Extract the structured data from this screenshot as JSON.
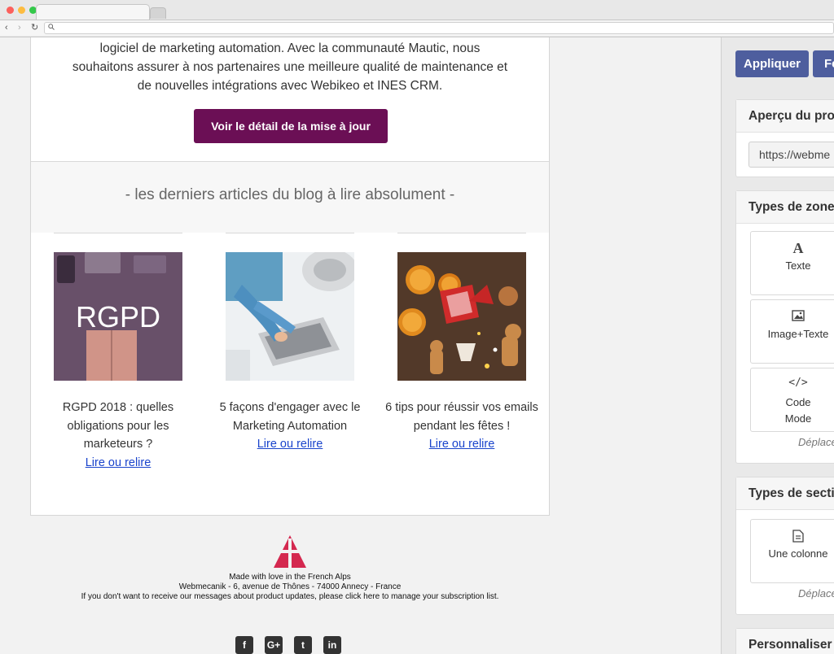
{
  "browser": {
    "back_label": "‹",
    "forward_label": "›",
    "reload_label": "↻",
    "url": ""
  },
  "email": {
    "intro_lines": [
      "logiciel de marketing automation. Avec la communauté Mautic, nous",
      "souhaitons assurer à nos partenaires une meilleure qualité de maintenance et",
      "de nouvelles intégrations avec Webikeo et INES CRM."
    ],
    "cta_label": "Voir le détail de la mise à jour",
    "blog_heading": "- les derniers articles du blog à lire absolument -",
    "articles": [
      {
        "thumb_text": "RGPD",
        "title": "RGPD 2018 : quelles obligations pour les marketeurs ?",
        "link": "Lire ou relire"
      },
      {
        "thumb_text": "",
        "title": "5 façons d'engager avec le Marketing Automation",
        "link": "Lire ou relire"
      },
      {
        "thumb_text": "",
        "title": "6 tips pour réussir vos emails pendant les fêtes !",
        "link": "Lire ou relire"
      }
    ],
    "footer": {
      "line1": "Made with love in the French Alps",
      "line2": "Webmecanik - 6, avenue de Thônes - 74000 Annecy - France",
      "line3": "If you don't want to receive our messages about product updates, please click here to manage your subscription list."
    },
    "social": [
      {
        "icon": "facebook-icon",
        "glyph": "f"
      },
      {
        "icon": "google-plus-icon",
        "glyph": "G+"
      },
      {
        "icon": "twitter-icon",
        "glyph": "t"
      },
      {
        "icon": "linkedin-icon",
        "glyph": "in"
      }
    ],
    "colors": {
      "cta": "#6b0f55",
      "link": "#1a44cc",
      "logo": "#d4284f"
    }
  },
  "sidebar": {
    "apply_label": "Appliquer",
    "close_label": "Fe",
    "preview_title": "Aperçu du pro",
    "preview_url": "https://webme",
    "zone_types_title": "Types de zone",
    "zone_blocks": [
      {
        "icon": "text-icon",
        "glyph": "A",
        "label": "Texte"
      },
      {
        "icon": "image-icon",
        "glyph": "▨",
        "label": "Image+Texte"
      },
      {
        "icon": "code-icon",
        "glyph": "</>",
        "label": "Code Mode"
      }
    ],
    "zone_drag_hint": "Déplace",
    "section_types_title": "Types de secti",
    "section_blocks": [
      {
        "icon": "document-icon",
        "glyph": "▤",
        "label": "Une colonne"
      }
    ],
    "section_drag_hint": "Déplace",
    "customize_title": "Personnaliser",
    "colors": {
      "button": "#4e5e9e"
    }
  }
}
